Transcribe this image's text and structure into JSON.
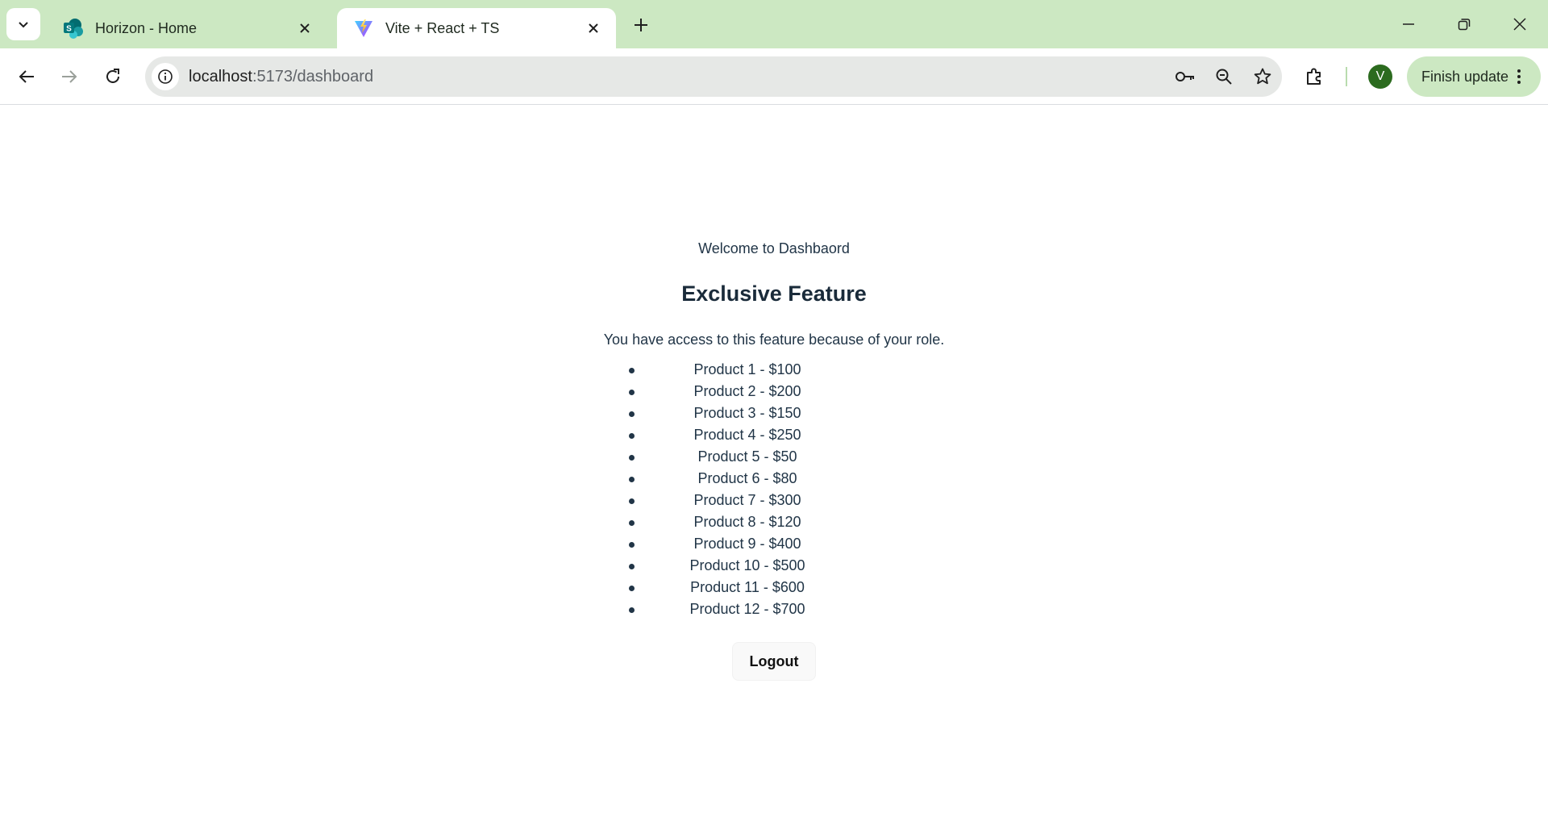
{
  "browser": {
    "tabs": [
      {
        "title": "Horizon - Home",
        "favicon": "sharepoint-icon",
        "active": false
      },
      {
        "title": "Vite + React + TS",
        "favicon": "vite-icon",
        "active": true
      }
    ],
    "address": {
      "host": "localhost",
      "path": ":5173/dashboard"
    },
    "profile_initial": "V",
    "update_label": "Finish update",
    "colors": {
      "frame": "#cce8c2",
      "omnibox": "#e6e8e6",
      "avatar": "#2c6b1f"
    }
  },
  "page": {
    "welcome": "Welcome to Dashbaord",
    "heading": "Exclusive Feature",
    "description": "You have access to this feature because of your role.",
    "products": [
      "Product 1 - $100",
      "Product 2 - $200",
      "Product 3 - $150",
      "Product 4 - $250",
      "Product 5 - $50",
      "Product 6 - $80",
      "Product 7 - $300",
      "Product 8 - $120",
      "Product 9 - $400",
      "Product 10 - $500",
      "Product 11 - $600",
      "Product 12 - $700"
    ],
    "logout_label": "Logout",
    "text_color": "#213547"
  }
}
